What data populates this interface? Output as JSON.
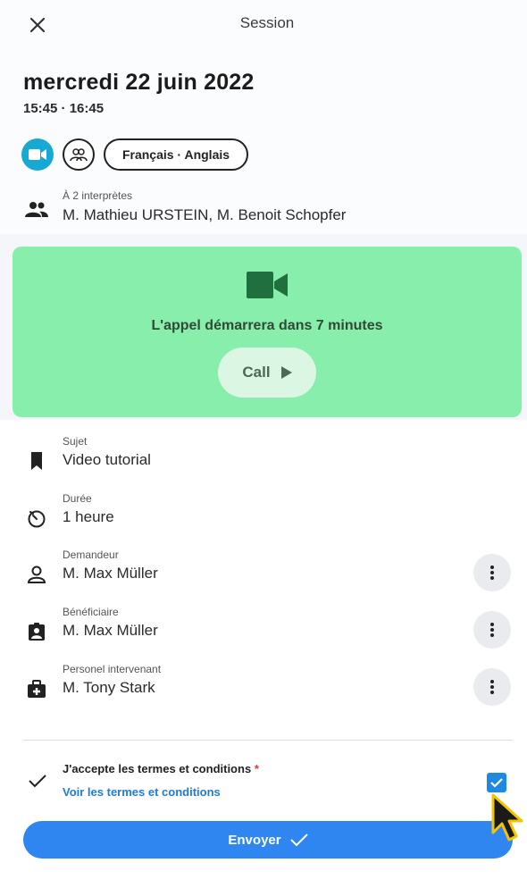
{
  "header": {
    "title": "Session",
    "close_icon": "close-icon"
  },
  "session": {
    "date": "mercredi 22 juin 2022",
    "time": "15:45 · 16:45",
    "language_chip": "Français · Anglais",
    "interpreters_label": "À 2 interprètes",
    "interpreters_names": "M. Mathieu URSTEIN, M. Benoit Schopfer"
  },
  "call": {
    "message": "L'appel démarrera dans 7 minutes",
    "button_label": "Call",
    "card_color": "#88eeab"
  },
  "details": [
    {
      "label": "Sujet",
      "value": "Video tutorial",
      "icon": "bookmark-icon"
    },
    {
      "label": "Durée",
      "value": "1 heure",
      "icon": "timer-icon"
    },
    {
      "label": "Demandeur",
      "value": "M. Max Müller",
      "icon": "person-icon"
    },
    {
      "label": "Bénéficiaire",
      "value": "M. Max Müller",
      "icon": "badge-icon"
    },
    {
      "label": "Personel intervenant",
      "value": "M. Tony Stark",
      "icon": "medical-bag-icon"
    }
  ],
  "terms": {
    "text": "J'accepte les termes et conditions",
    "required_mark": "*",
    "link": "Voir les termes et conditions",
    "checked": true
  },
  "submit": {
    "label": "Envoyer"
  },
  "colors": {
    "accent": "#2f86f0",
    "video_chip": "#16a9d4",
    "link": "#1e7be0",
    "required": "#e53935"
  }
}
